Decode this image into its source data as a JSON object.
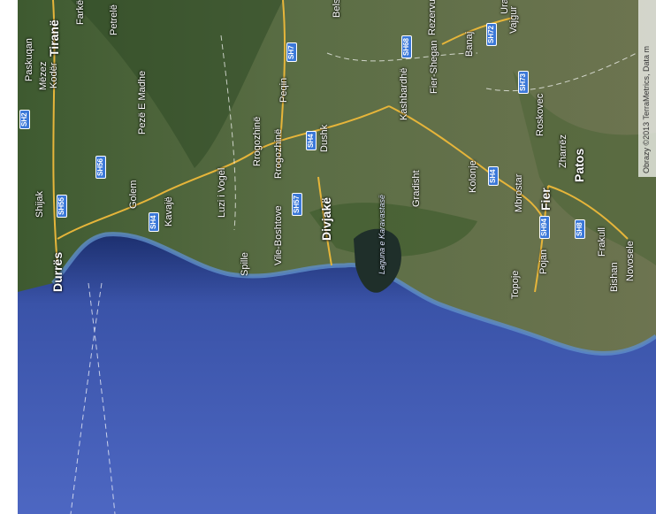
{
  "map": {
    "view": "satellite",
    "attribution": "Obrazy ©2013 TerraMetrics, Data m",
    "places": [
      {
        "id": "tirane",
        "label": "Tiranë",
        "big": true
      },
      {
        "id": "paskuqan",
        "label": "Paskuqan"
      },
      {
        "id": "mezez",
        "label": "Mëzez"
      },
      {
        "id": "koder",
        "label": "Kodër"
      },
      {
        "id": "farke",
        "label": "Farkë"
      },
      {
        "id": "petrele",
        "label": "Petrelë"
      },
      {
        "id": "belsh",
        "label": "Belsh"
      },
      {
        "id": "uraj",
        "label": "Ura"
      },
      {
        "id": "vajgure",
        "label": "Vajgur"
      },
      {
        "id": "peze",
        "label": "Pezë E Madhe"
      },
      {
        "id": "golem",
        "label": "Golem"
      },
      {
        "id": "shijak",
        "label": "Shijak"
      },
      {
        "id": "durres",
        "label": "Durrës",
        "big": true
      },
      {
        "id": "kavaje",
        "label": "Kavajë"
      },
      {
        "id": "luzi",
        "label": "Luzi i Vogël"
      },
      {
        "id": "spille",
        "label": "Spille"
      },
      {
        "id": "rrogozhine1",
        "label": "Rrogozhinë"
      },
      {
        "id": "rrogozhine2",
        "label": "Rrogozhinë"
      },
      {
        "id": "peqin",
        "label": "Peqin"
      },
      {
        "id": "vile",
        "label": "Vile-Boshtove"
      },
      {
        "id": "divjake",
        "label": "Divjakë"
      },
      {
        "id": "dushk",
        "label": "Dushk"
      },
      {
        "id": "kashbardhe",
        "label": "Kashbardhë"
      },
      {
        "id": "fiershegan",
        "label": "Fier-Shegan"
      },
      {
        "id": "rezerv",
        "label": "Rezervuar Murriz"
      },
      {
        "id": "banaj",
        "label": "Banaj"
      },
      {
        "id": "gradisht",
        "label": "Gradisht"
      },
      {
        "id": "kolonje",
        "label": "Kolonje"
      },
      {
        "id": "mbrostar",
        "label": "Mbrostar"
      },
      {
        "id": "fier",
        "label": "Fier",
        "big": true
      },
      {
        "id": "roskovec",
        "label": "Roskovec"
      },
      {
        "id": "zharrez",
        "label": "Zharrëz"
      },
      {
        "id": "patos",
        "label": "Patos"
      },
      {
        "id": "frakull",
        "label": "Frakull"
      },
      {
        "id": "novosele",
        "label": "Novosele"
      },
      {
        "id": "bishan",
        "label": "Bishan"
      },
      {
        "id": "pojan",
        "label": "Pojan"
      },
      {
        "id": "topoje",
        "label": "Topoje"
      },
      {
        "id": "laguna",
        "label": "Laguna e Karavastasë",
        "lagoon": true
      }
    ],
    "shields": [
      "SH2",
      "SH56",
      "SH55",
      "SH4",
      "SH7",
      "SH4",
      "SH57",
      "SH68",
      "SH72",
      "SH73",
      "SH4",
      "SH94",
      "SH8"
    ]
  }
}
